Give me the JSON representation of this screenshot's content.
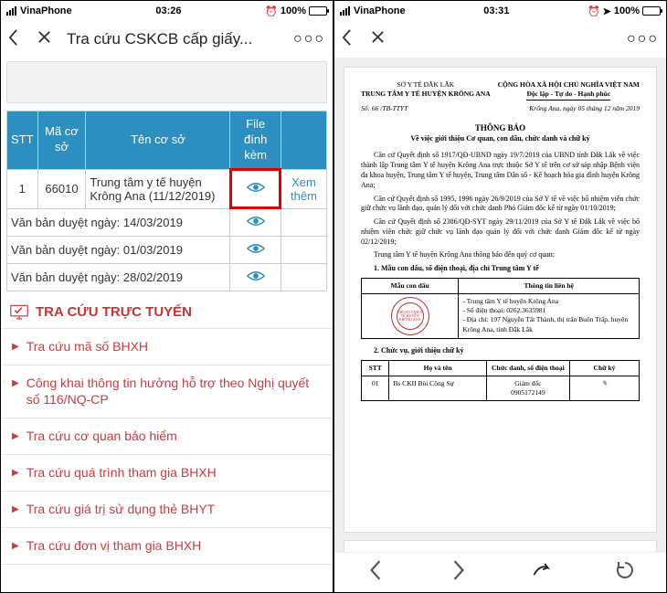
{
  "left": {
    "status": {
      "carrier": "VinaPhone",
      "time": "03:26",
      "battery": "100%",
      "alarm_icon": true
    },
    "titlebar": {
      "title": "Tra cứu CSKCB cấp giấy..."
    },
    "table": {
      "headers": {
        "stt": "STT",
        "ma": "Mã cơ sở",
        "ten": "Tên cơ sở",
        "file": "File đính kèm",
        "extra": ""
      },
      "row": {
        "stt": "1",
        "ma": "66010",
        "ten": "Trung tâm y tế huyện Krông Ana (11/12/2019)",
        "xem": "Xem thêm"
      },
      "approvals": {
        "a1": "Văn bản duyệt ngày: 14/03/2019",
        "a2": "Văn bản duyệt ngày: 01/03/2019",
        "a3": "Văn bản duyệt ngày: 28/02/2019"
      }
    },
    "section_title": "TRA CỨU TRỰC TUYẾN",
    "links": {
      "l1": "Tra cứu mã số BHXH",
      "l2": "Công khai thông tin hưởng hỗ trợ theo Nghị quyết số 116/NQ-CP",
      "l3": "Tra cứu cơ quan bảo hiểm",
      "l4": "Tra cứu quá trình tham gia BHXH",
      "l5": "Tra cứu giá trị sử dụng thẻ BHYT",
      "l6": "Tra cứu đơn vị tham gia BHXH"
    }
  },
  "right": {
    "status": {
      "carrier": "VinaPhone",
      "time": "03:31",
      "battery": "100%",
      "location_icon": true,
      "alarm_icon": true
    },
    "doc": {
      "org1": "SỞ Y TẾ ĐẮK LẮK",
      "org2": "TRUNG TÂM Y TẾ HUYỆN KRÔNG ANA",
      "nation": "CỘNG HÒA XÃ HỘI CHỦ NGHĨA VIỆT NAM",
      "motto": "Độc lập - Tự do - Hạnh phúc",
      "docno": "Số: 66 /TB-TTYT",
      "placedate": "Krông Ana, ngày 05 tháng 12 năm 2019",
      "title": "THÔNG BÁO",
      "subtitle": "Về việc giới thiệu Cơ quan, con dấu, chức danh và chữ ký",
      "p1": "Căn cứ Quyết định số 1917/QĐ-UBND ngày 19/7/2019 của UBND tỉnh Đắk Lắk về việc thành lập Trung tâm Y tế huyện Krông Ana trực thuộc Sở Y tế trên cơ sở sáp nhập Bệnh viện đa khoa huyện, Trung tâm Y tế huyện, Trung tâm Dân số - Kế hoạch hóa gia đình huyện Krông Ana;",
      "p2": "Căn cứ Quyết định số 1995, 1996 ngày 26/9/2019 của Sở Y tế về việc bổ nhiệm viên chức giữ chức vụ lãnh đạo, quản lý đối với chức danh Phó Giám đốc kể từ ngày 01/10/2019;",
      "p3": "Căn cứ Quyết định số 2386/QĐ-SYT ngày 29/11/2019 của Sở Y tế Đắk Lắk về việc bổ nhiệm viên chức giữ chức vụ lãnh đạo quản lý đối với chức danh Giám đốc kể từ ngày 02/12/2019;",
      "p4": "Trung tâm Y tế huyện Krông Ana thông báo đến quý cơ quan:",
      "h1": "1. Mẫu con dấu, số điện thoại, địa chỉ Trung tâm Y tế",
      "t1": {
        "h_stamp": "Mẫu con dấu",
        "h_contact": "Thông tin liên hệ",
        "stamp_text": "TRUNG TÂM Y TẾ HUYỆN KRÔNG ANA",
        "contact1": "- Trung tâm Y tế huyện Krông Ana",
        "contact2": "- Số điện thoại: 0262.3635981",
        "contact3": "- Địa chỉ: 197 Nguyễn Tất Thành, thị trấn Buôn Trấp, huyện Krông Ana, tỉnh Đắk Lắk"
      },
      "h2": "2. Chức vụ, giới thiệu chữ ký",
      "t2": {
        "h_stt": "STT",
        "h_name": "Họ và tên",
        "h_pos": "Chức danh, số điện thoại",
        "h_sig": "Chữ ký",
        "r_stt": "01",
        "r_name": "Bs CKII Bùi Công Sự",
        "r_pos1": "Giám đốc",
        "r_pos2": "0905172149"
      }
    }
  }
}
